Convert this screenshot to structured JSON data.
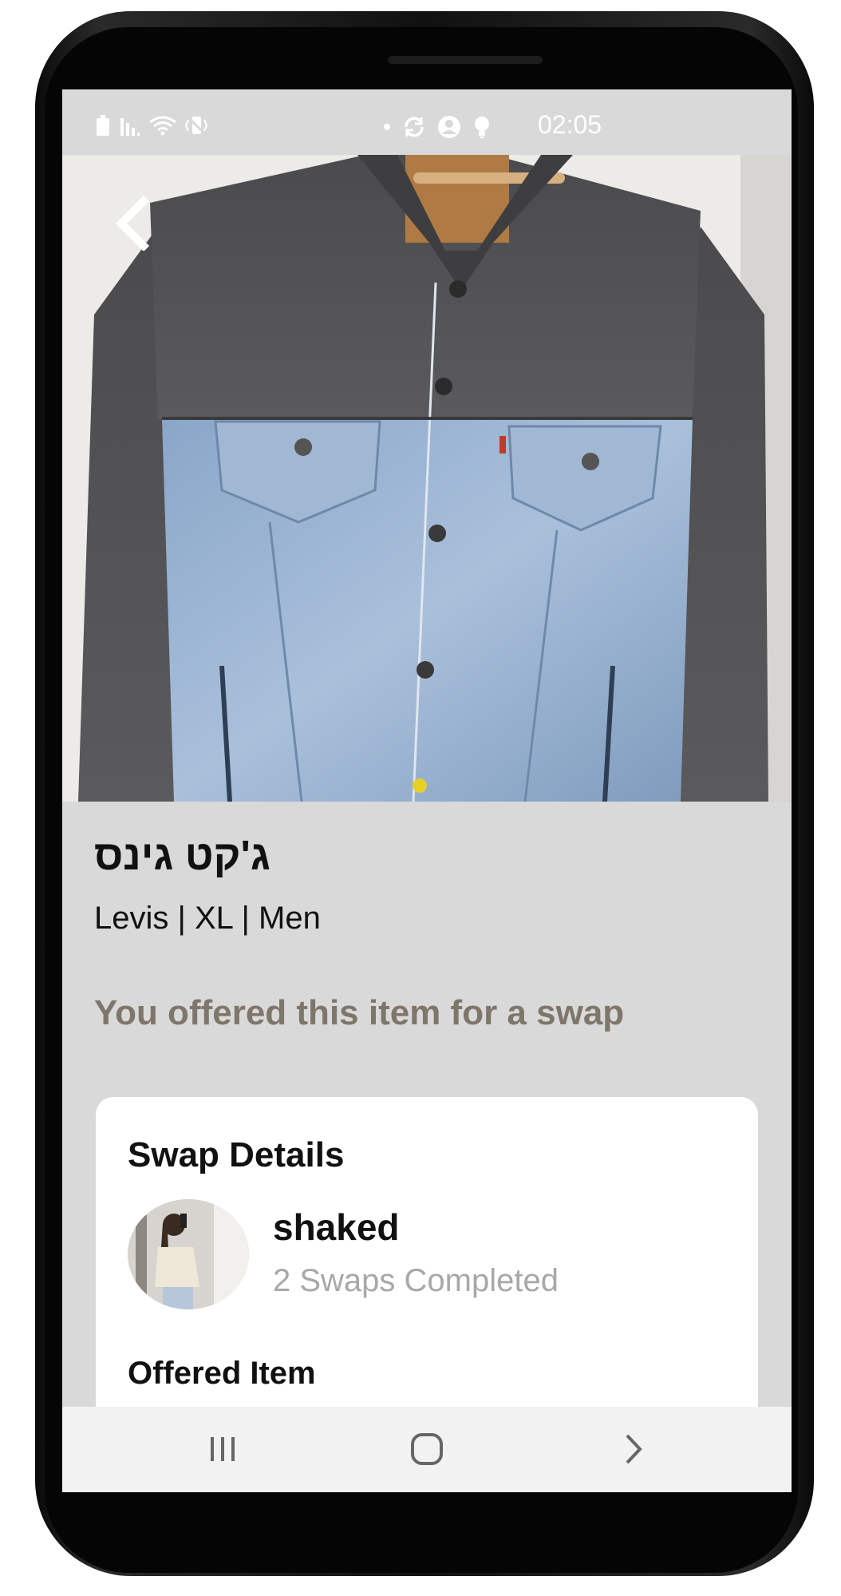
{
  "status_bar": {
    "time": "02:05",
    "left_icons": [
      "battery-icon",
      "signal-icon",
      "wifi-icon",
      "vibrate-icon"
    ],
    "right_icons": [
      "dot-icon",
      "sync-icon",
      "account-icon",
      "bulb-icon"
    ]
  },
  "item": {
    "title": "ג'קט גינס",
    "details": "Levis | XL | Men",
    "status_note": "You offered this item for a swap"
  },
  "swap_details": {
    "heading": "Swap Details",
    "user_name": "shaked",
    "swaps_completed": "2 Swaps Completed",
    "offered_item_heading": "Offered Item"
  },
  "colors": {
    "screen_bg": "#d9d9d9",
    "note_color": "#7f766b",
    "muted_text": "#a8a8a8",
    "card_bg": "#ffffff"
  },
  "nav_bar": {
    "icons": [
      "recents-icon",
      "home-icon",
      "back-chevron-icon"
    ]
  }
}
